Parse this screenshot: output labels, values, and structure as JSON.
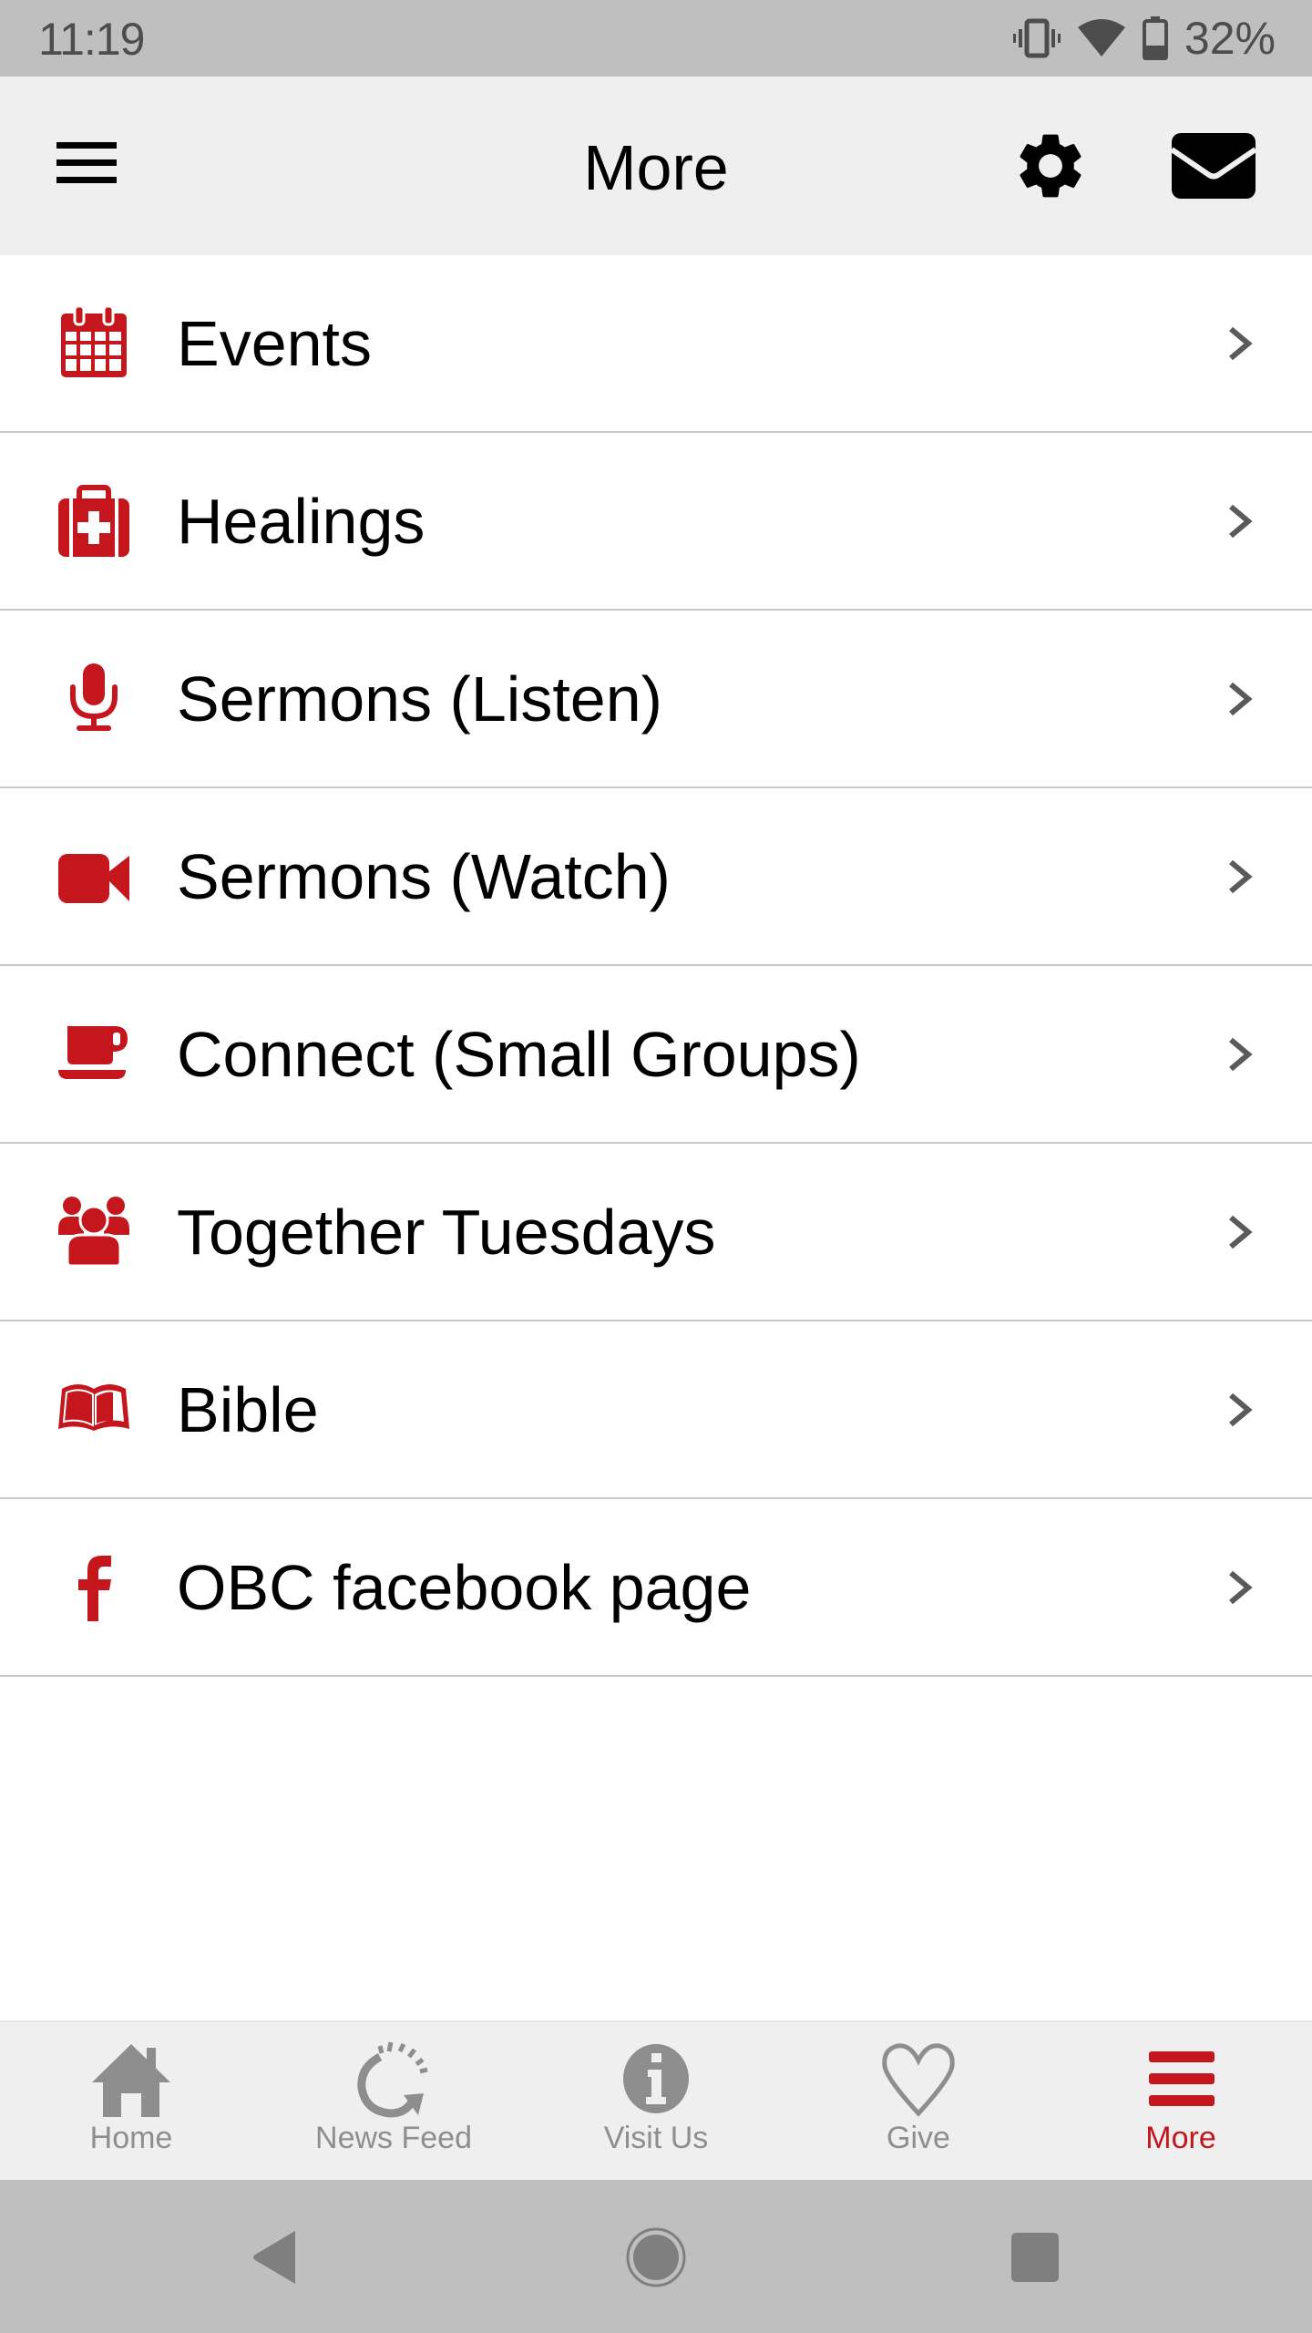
{
  "status_bar": {
    "time": "11:19",
    "battery_percent": "32%",
    "icons": [
      "vibrate-icon",
      "wifi-icon",
      "battery-icon"
    ]
  },
  "app_bar": {
    "title": "More",
    "left_icon": "hamburger-menu-icon",
    "right_icons": [
      "gear-icon",
      "envelope-icon"
    ]
  },
  "colors": {
    "accent": "#c4161c",
    "nav_inactive": "#8e8e8e",
    "appbar_bg": "#efefef",
    "statusbar_bg": "#bfbfbf",
    "divider": "#c8c8c8"
  },
  "menu": {
    "items": [
      {
        "label": "Events",
        "icon": "calendar-icon"
      },
      {
        "label": "Healings",
        "icon": "medical-kit-icon"
      },
      {
        "label": "Sermons (Listen)",
        "icon": "microphone-icon"
      },
      {
        "label": "Sermons (Watch)",
        "icon": "video-camera-icon"
      },
      {
        "label": "Connect (Small Groups)",
        "icon": "coffee-cup-icon"
      },
      {
        "label": "Together Tuesdays",
        "icon": "group-icon"
      },
      {
        "label": "Bible",
        "icon": "open-book-icon"
      },
      {
        "label": "OBC facebook page",
        "icon": "facebook-icon"
      }
    ]
  },
  "bottom_nav": {
    "active": "More",
    "items": [
      {
        "label": "Home",
        "icon": "home-icon"
      },
      {
        "label": "News Feed",
        "icon": "refresh-feed-icon"
      },
      {
        "label": "Visit Us",
        "icon": "info-icon"
      },
      {
        "label": "Give",
        "icon": "heart-icon"
      },
      {
        "label": "More",
        "icon": "menu-lines-icon"
      }
    ]
  },
  "system_nav": {
    "buttons": [
      "back",
      "home",
      "recents"
    ]
  }
}
